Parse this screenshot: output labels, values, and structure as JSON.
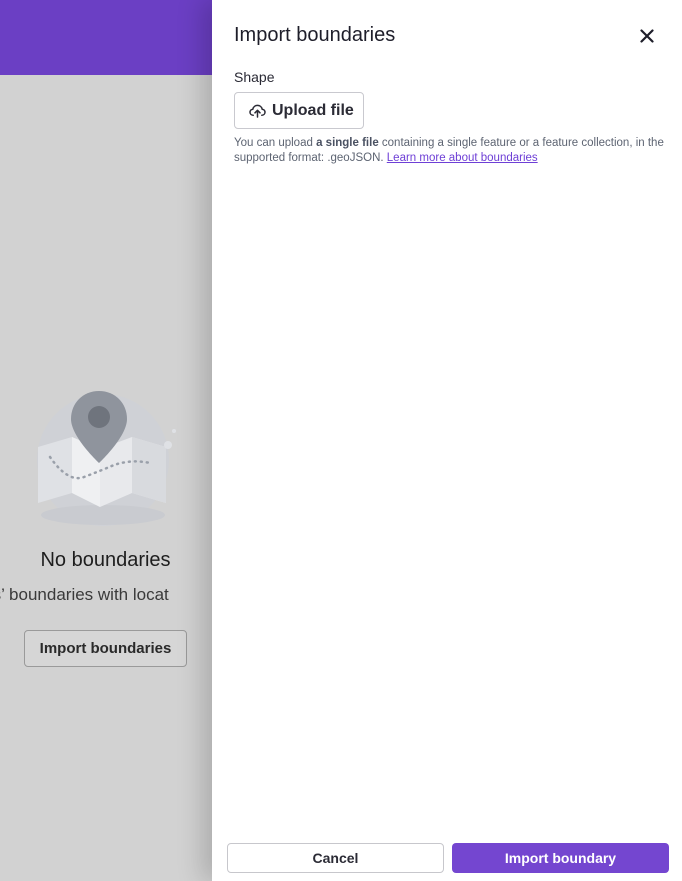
{
  "background": {
    "header_color": "#6b3fc4",
    "empty_state": {
      "icon": "map-pin-icon",
      "title": "No boundaries",
      "description": "ools’ boundaries with locat",
      "button_label": "Import boundaries"
    }
  },
  "drawer": {
    "title": "Import boundaries",
    "close_icon": "close-icon",
    "shape": {
      "label": "Shape",
      "upload_label": "Upload file",
      "upload_icon": "cloud-upload-icon"
    },
    "help": {
      "prefix": "You can upload ",
      "bold": "a single file",
      "middle": " containing a single feature or a feature collection, in the supported format: .geoJSON. ",
      "link": "Learn more about boundaries"
    },
    "footer": {
      "cancel_label": "Cancel",
      "submit_label": "Import boundary"
    },
    "accent_color": "#7446d0"
  }
}
